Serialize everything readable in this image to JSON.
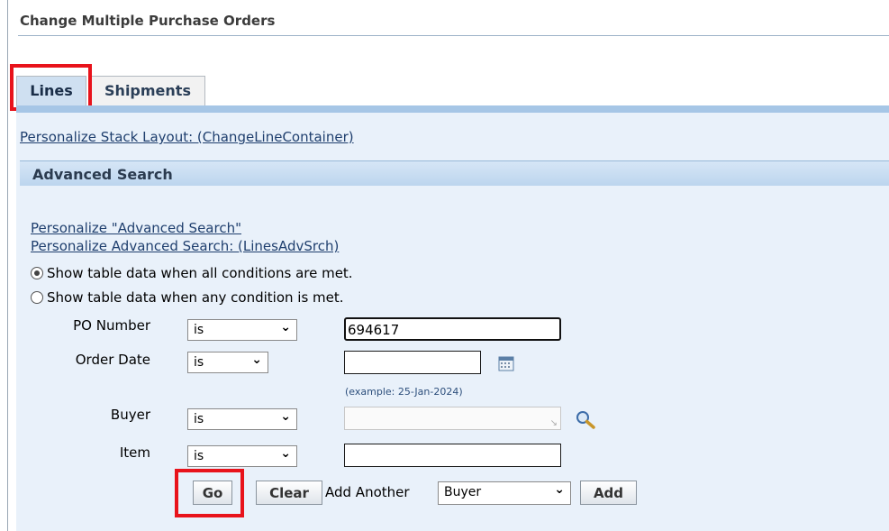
{
  "page": {
    "title": "Change Multiple Purchase Orders"
  },
  "tabs": [
    {
      "label": "Lines",
      "selected": true
    },
    {
      "label": "Shipments",
      "selected": false
    }
  ],
  "links": {
    "personalize_stack": "Personalize Stack Layout: (ChangeLineContainer)",
    "personalize_adv": "Personalize \"Advanced Search\"",
    "personalize_adv_lines": "Personalize Advanced Search: (LinesAdvSrch)"
  },
  "advanced_search": {
    "header": "Advanced Search",
    "radio_all": {
      "label": "Show table data when all conditions are met.",
      "checked": true
    },
    "radio_any": {
      "label": "Show table data when any condition is met.",
      "checked": false
    },
    "fields": [
      {
        "label": "PO Number",
        "operator": "is",
        "value": ""
      },
      {
        "label": "Order Date",
        "operator": "is",
        "value": "",
        "hint": "(example: 25-Jan-2024)"
      },
      {
        "label": "Buyer",
        "operator": "is",
        "value": ""
      },
      {
        "label": "Item",
        "operator": "is",
        "value": ""
      }
    ],
    "po_number_value": "694617",
    "go_label": "Go",
    "clear_label": "Clear",
    "add_another_label": "Add Another",
    "add_another_selected": "Buyer",
    "add_label": "Add"
  },
  "icons": {
    "calendar": "calendar-icon",
    "search": "magnifier-icon",
    "chevron": "chevron-down-icon"
  },
  "colors": {
    "highlight": "#e8131b",
    "link": "#1f3f6e",
    "header_bg": "#cfe0f1"
  }
}
